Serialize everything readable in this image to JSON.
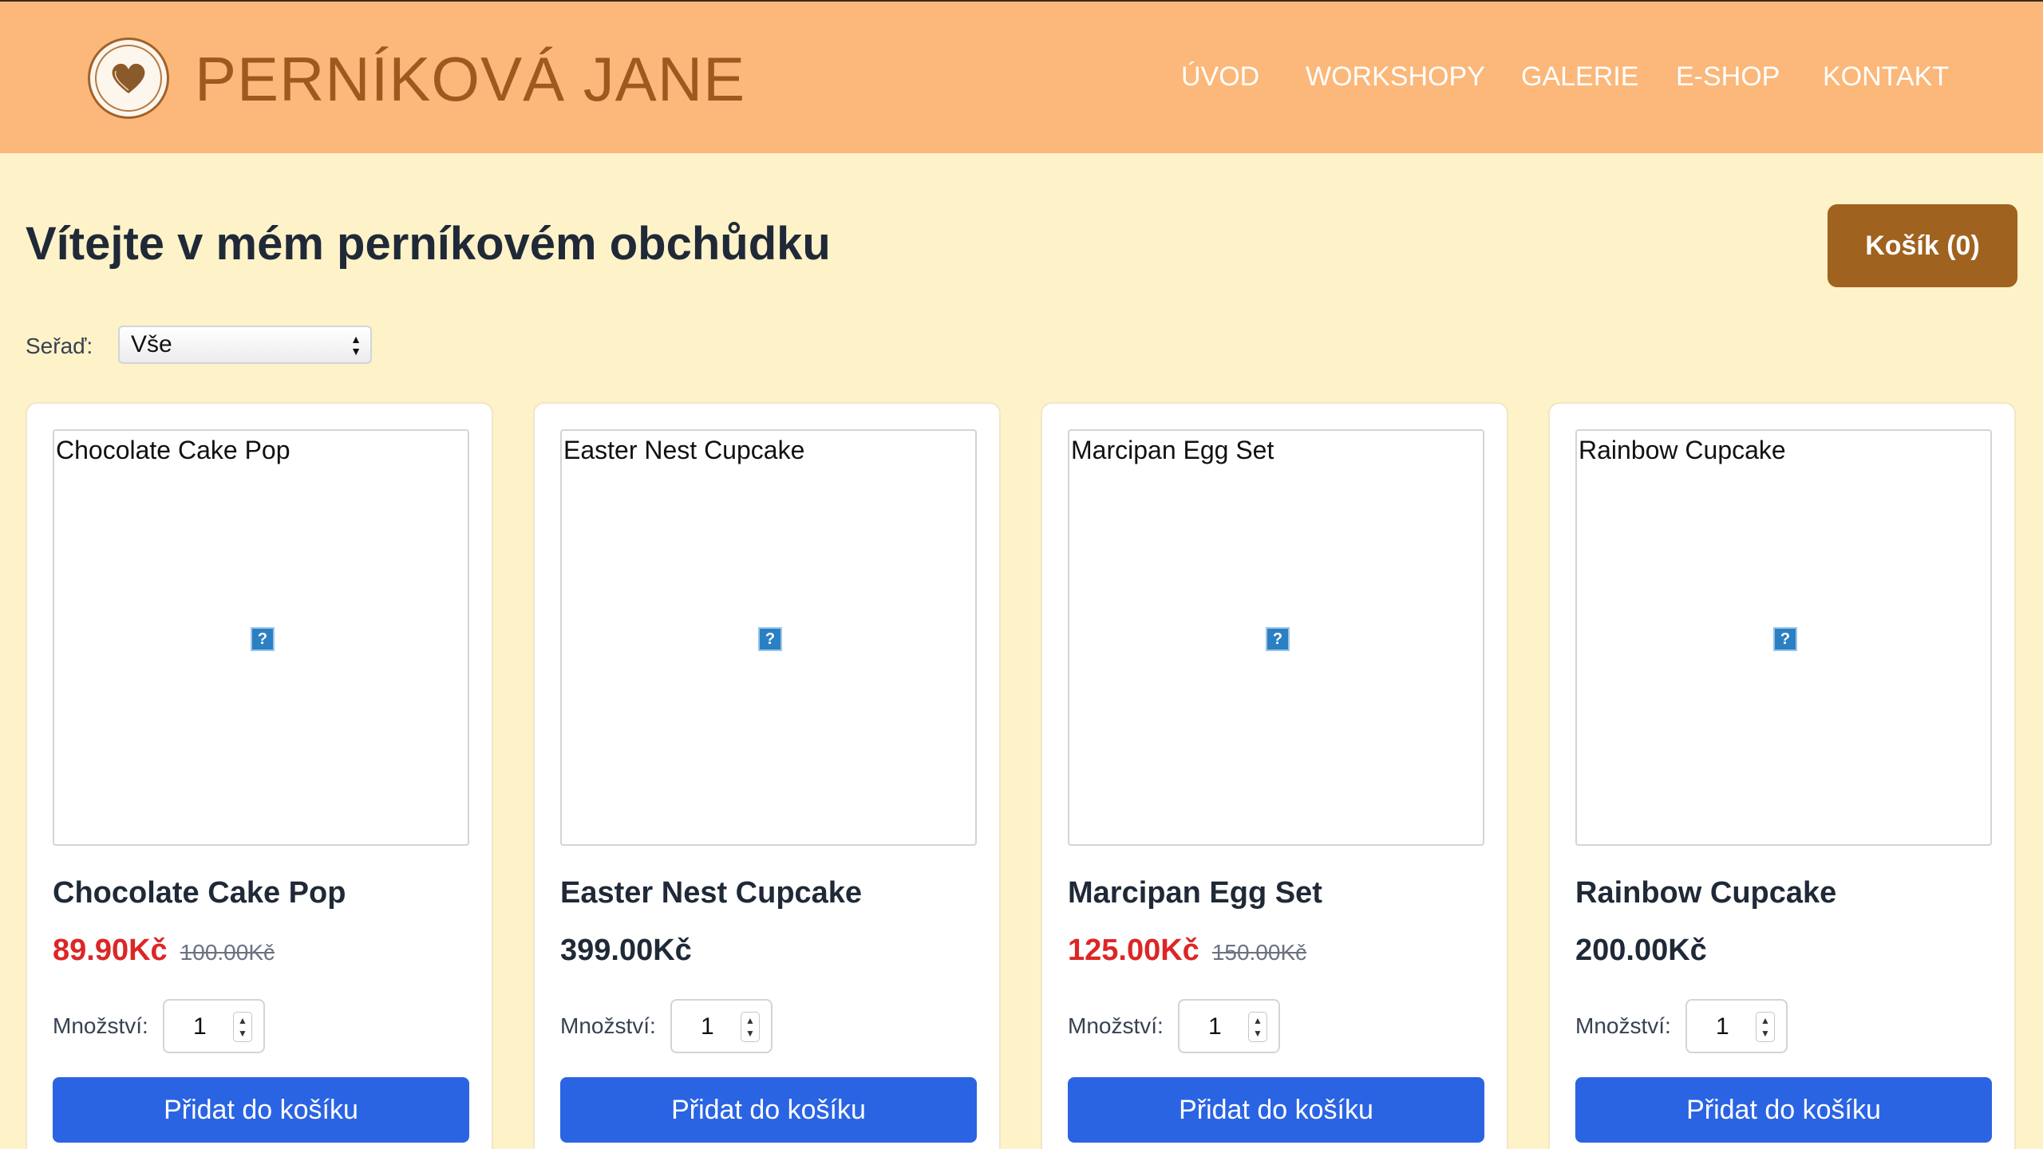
{
  "header": {
    "brand": "PERNÍKOVÁ JANE",
    "nav": [
      "ÚVOD",
      "WORKSHOPY",
      "GALERIE",
      "E-SHOP",
      "KONTAKT"
    ]
  },
  "main": {
    "title": "Vítejte v mém perníkovém obchůdku",
    "cart_label": "Košík (0)",
    "sort_label": "Seřaď:",
    "sort_value": "Vše"
  },
  "products": [
    {
      "name": "Chocolate Cake Pop",
      "price": "89.90Kč",
      "old_price": "100.00Kč",
      "on_sale": true,
      "qty_label": "Množství:",
      "qty": "1",
      "button": "Přidat do košíku",
      "image_alt": "Chocolate Cake Pop"
    },
    {
      "name": "Easter Nest Cupcake",
      "price": "399.00Kč",
      "old_price": "",
      "on_sale": false,
      "qty_label": "Množství:",
      "qty": "1",
      "button": "Přidat do košíku",
      "image_alt": "Easter Nest Cupcake"
    },
    {
      "name": "Marcipan Egg Set",
      "price": "125.00Kč",
      "old_price": "150.00Kč",
      "on_sale": true,
      "qty_label": "Množství:",
      "qty": "1",
      "button": "Přidat do košíku",
      "image_alt": "Marcipan Egg Set"
    },
    {
      "name": "Rainbow Cupcake",
      "price": "200.00Kč",
      "old_price": "",
      "on_sale": false,
      "qty_label": "Množství:",
      "qty": "1",
      "button": "Přidat do košíku",
      "image_alt": "Rainbow Cupcake"
    }
  ],
  "colors": {
    "header_bg": "#fbb87a",
    "page_bg": "#fef2c9",
    "brand_text": "#9c5a1f",
    "cart_button": "#a0621f",
    "add_button": "#2b64e3",
    "sale_price": "#dc2626"
  },
  "icons": {
    "logo": "heart-seal-logo",
    "broken_image": "broken-image-icon",
    "select_arrows": "updown-arrows-icon",
    "spinner": "spinner-arrows-icon"
  }
}
